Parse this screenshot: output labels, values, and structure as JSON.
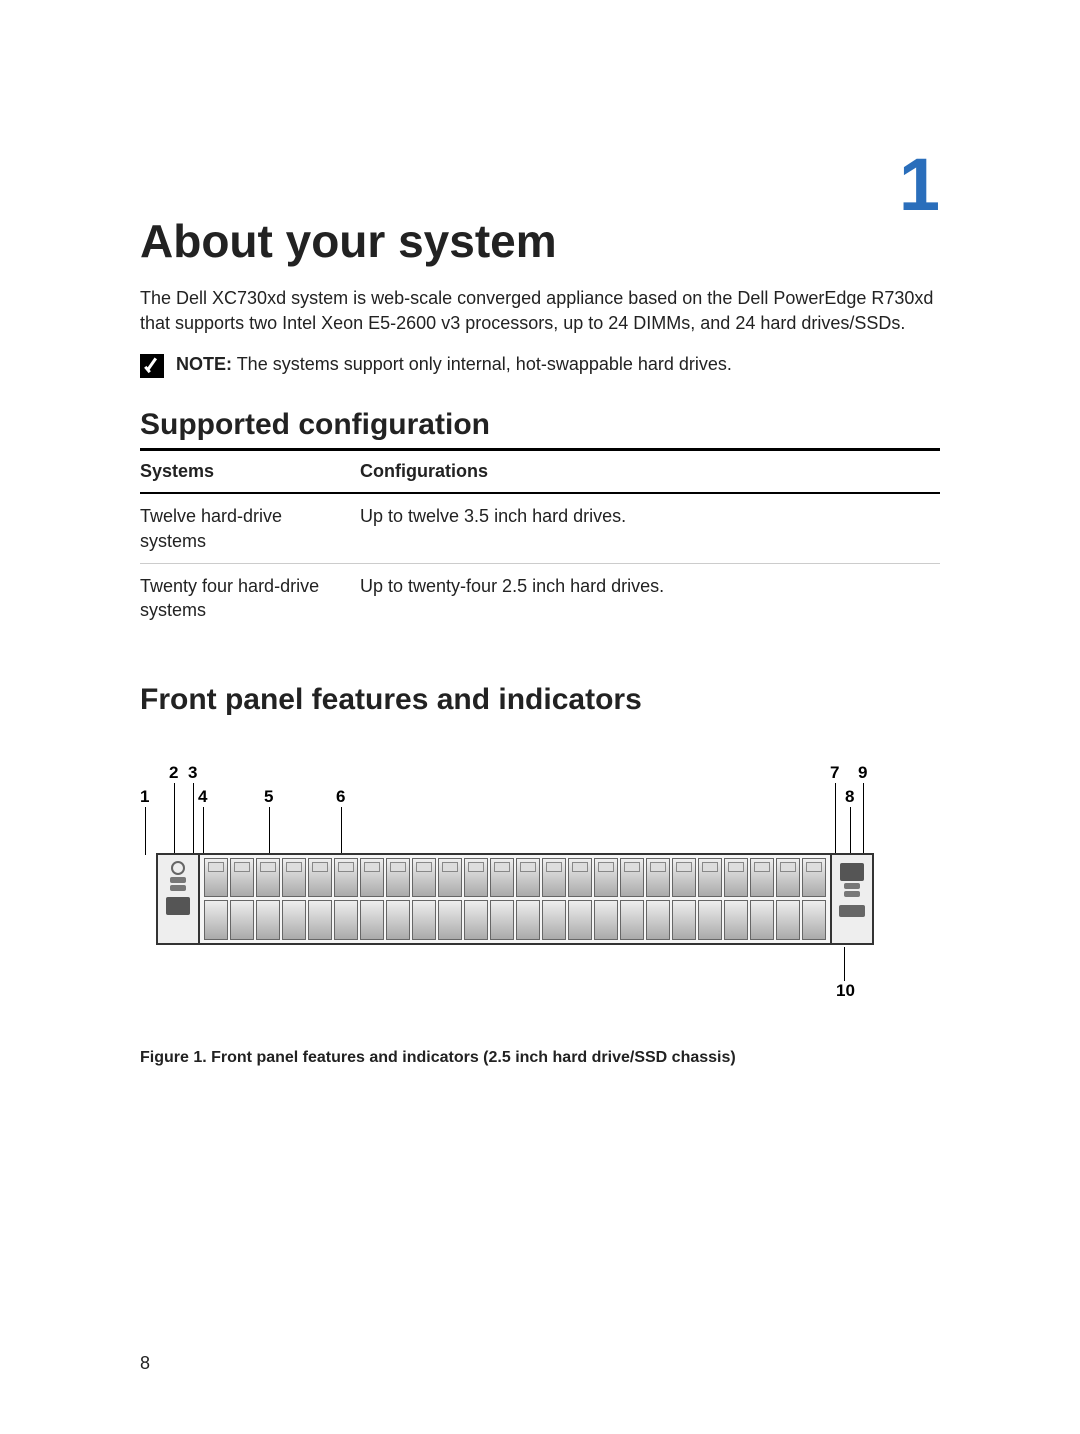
{
  "chapter_number": "1",
  "h1": "About your system",
  "intro": "The Dell XC730xd system is web-scale converged appliance based on the Dell PowerEdge R730xd that supports two Intel Xeon E5-2600 v3 processors, up to 24 DIMMs, and 24 hard drives/SSDs.",
  "note": {
    "label": "NOTE:",
    "text": "The systems support only internal, hot-swappable hard drives."
  },
  "h2_supported": "Supported configuration",
  "table": {
    "headers": [
      "Systems",
      "Configurations"
    ],
    "rows": [
      {
        "system": "Twelve hard-drive systems",
        "config": "Up to twelve 3.5 inch hard drives."
      },
      {
        "system": "Twenty four hard-drive systems",
        "config": "Up to twenty-four 2.5 inch hard drives."
      }
    ]
  },
  "h2_front": "Front panel features and indicators",
  "figure": {
    "callouts": [
      "1",
      "2",
      "3",
      "4",
      "5",
      "6",
      "7",
      "8",
      "9",
      "10"
    ],
    "caption": "Figure 1. Front panel features and indicators (2.5 inch hard drive/SSD chassis)"
  },
  "page_number": "8"
}
